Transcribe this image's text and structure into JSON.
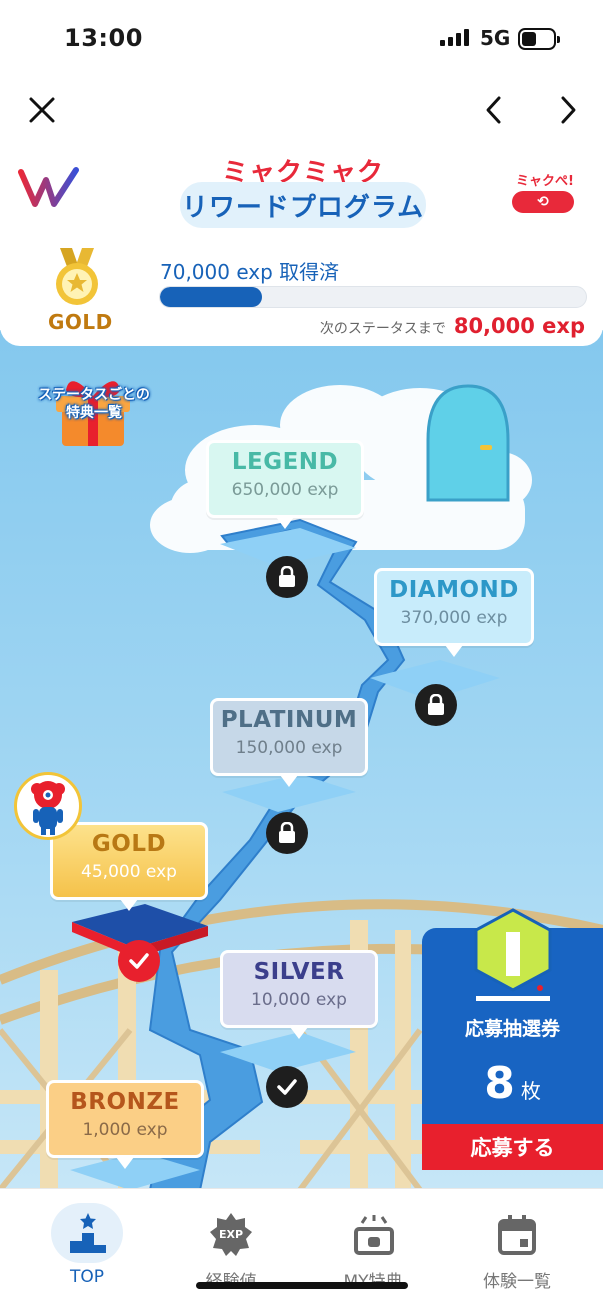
{
  "status": {
    "time": "13:00",
    "network": "5G"
  },
  "app": {
    "title_line1": "ミャクミャク",
    "title_line2": "リワードプログラム",
    "myakupe": "ミャクぺ!"
  },
  "status_card": {
    "current_status": "GOLD",
    "earned": "70,000 exp 取得済",
    "progress": 0.24,
    "next_label": "次のステータスまで",
    "next_value": "80,000 exp"
  },
  "benefits_link": {
    "line1": "ステータスごとの",
    "line2": "特典一覧"
  },
  "tiers": [
    {
      "name": "LEGEND",
      "exp": "650,000 exp",
      "state": "locked"
    },
    {
      "name": "DIAMOND",
      "exp": "370,000 exp",
      "state": "locked"
    },
    {
      "name": "PLATINUM",
      "exp": "150,000 exp",
      "state": "locked"
    },
    {
      "name": "GOLD",
      "exp": "45,000 exp",
      "state": "current"
    },
    {
      "name": "SILVER",
      "exp": "10,000 exp",
      "state": "done"
    },
    {
      "name": "BRONZE",
      "exp": "1,000 exp",
      "state": "done"
    }
  ],
  "lottery": {
    "title": "応募抽選券",
    "count": "8",
    "unit": "枚",
    "button": "応募する"
  },
  "tabs": [
    {
      "label": "TOP",
      "icon": "podium-icon",
      "active": true
    },
    {
      "label": "経験値",
      "icon": "exp-badge-icon",
      "active": false
    },
    {
      "label": "MY特典",
      "icon": "gift-box-icon",
      "active": false
    },
    {
      "label": "体験一覧",
      "icon": "calendar-icon",
      "active": false
    }
  ],
  "colors": {
    "primary": "#1762b8",
    "accent_red": "#e8202d",
    "sky": "#a3d7f3",
    "gold": "#f2c438"
  }
}
